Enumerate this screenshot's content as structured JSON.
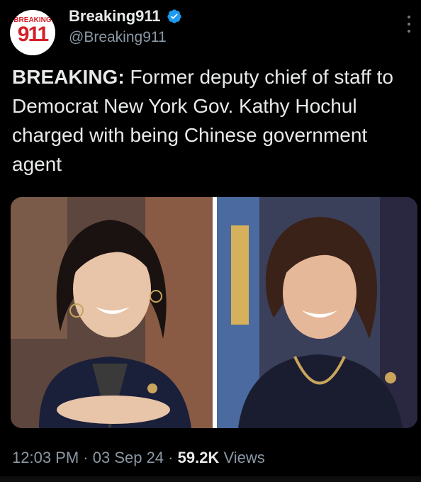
{
  "account": {
    "avatar_text_top": "BREAKING",
    "avatar_text_number": "911",
    "display_name": "Breaking911",
    "handle": "@Breaking911",
    "verified_icon": "verified-badge-icon",
    "verified_color": "#1d9bf0"
  },
  "more_menu_icon": "more-vertical-icon",
  "tweet": {
    "lead": "BREAKING:",
    "body": " Former deputy chief of staff to Democrat New York Gov. Kathy Hochul charged with being Chinese government agent"
  },
  "meta": {
    "time": "12:03 PM",
    "separator1": " · ",
    "date": "03 Sep 24",
    "separator2": " · ",
    "views_count": "59.2K",
    "views_label": " Views"
  },
  "colors": {
    "background": "#000000",
    "text_primary": "#e7e9ea",
    "text_secondary": "#8b98a5",
    "brand_red": "#d52027"
  }
}
